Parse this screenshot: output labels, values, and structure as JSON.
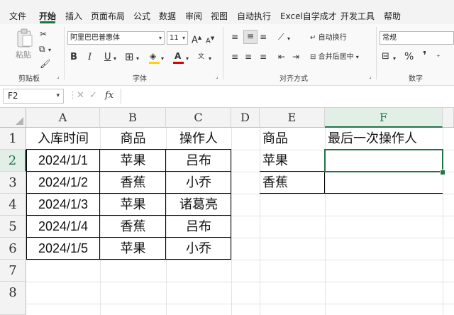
{
  "menu": {
    "items": [
      "文件",
      "开始",
      "插入",
      "页面布局",
      "公式",
      "数据",
      "审阅",
      "视图",
      "自动执行",
      "Excel自学成才",
      "开发工具",
      "帮助"
    ],
    "active": "开始"
  },
  "ribbon": {
    "clipboard": {
      "paste_label": "粘贴",
      "group_label": "剪贴板"
    },
    "font": {
      "font_name": "阿里巴巴普惠体",
      "font_size": "11",
      "grow_label": "A",
      "shrink_label": "A",
      "bold": "B",
      "italic": "I",
      "underline": "U",
      "group_label": "字体"
    },
    "alignment": {
      "wrap_label": "自动换行",
      "merge_label": "合并后居中",
      "group_label": "对齐方式"
    },
    "number": {
      "format": "常规",
      "percent": "%",
      "group_label": "数字"
    }
  },
  "formula_bar": {
    "name_box": "F2",
    "fx": "fx",
    "content": ""
  },
  "sheet": {
    "columns": [
      "A",
      "B",
      "C",
      "D",
      "E",
      "F"
    ],
    "rows": [
      "1",
      "2",
      "3",
      "4",
      "5",
      "6",
      "7",
      "8"
    ],
    "selected_cell": "F2",
    "table1": [
      [
        "入库时间",
        "商品",
        "操作人"
      ],
      [
        "2024/1/1",
        "苹果",
        "吕布"
      ],
      [
        "2024/1/2",
        "香蕉",
        "小乔"
      ],
      [
        "2024/1/3",
        "苹果",
        "诸葛亮"
      ],
      [
        "2024/1/4",
        "香蕉",
        "吕布"
      ],
      [
        "2024/1/5",
        "苹果",
        "小乔"
      ]
    ],
    "table2": [
      [
        "商品",
        "最后一次操作人"
      ],
      [
        "苹果",
        ""
      ],
      [
        "香蕉",
        ""
      ]
    ]
  },
  "colors": {
    "accent": "#217346",
    "header_bg": "#f3f3f3",
    "menu_bg": "#f3f3f3",
    "font_red": "#e00000",
    "highlight_yellow": "#ffd400"
  }
}
